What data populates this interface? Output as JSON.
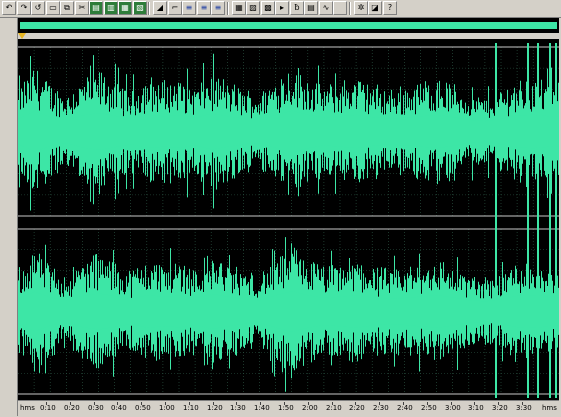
{
  "toolbar": {
    "groups": [
      [
        {
          "name": "undo-button",
          "icon": "undo-icon",
          "glyph": "↶"
        },
        {
          "name": "redo-button",
          "icon": "redo-icon",
          "glyph": "↷"
        },
        {
          "name": "repeat-command-button",
          "icon": "repeat-icon",
          "glyph": "↺"
        },
        {
          "name": "open-button",
          "icon": "folder-icon",
          "glyph": "▭"
        },
        {
          "name": "copy-button",
          "icon": "copy-icon",
          "glyph": "⧉"
        },
        {
          "name": "cut-button",
          "icon": "scissors-icon",
          "glyph": "✂"
        },
        {
          "name": "paste-button",
          "icon": "paste-icon",
          "glyph": "▤"
        },
        {
          "name": "mix-paste-button",
          "icon": "mix-paste-icon",
          "glyph": "▥"
        },
        {
          "name": "trim-button",
          "icon": "trim-icon",
          "glyph": "▦"
        },
        {
          "name": "extract-button",
          "icon": "extract-icon",
          "glyph": "▧"
        }
      ],
      [
        {
          "name": "crossfade-button",
          "icon": "crossfade-icon",
          "glyph": "◢"
        },
        {
          "name": "fade-button",
          "icon": "fade-icon",
          "glyph": "⌐"
        },
        {
          "name": "view-left-channel-button",
          "icon": "channel-icon",
          "glyph": "≡"
        },
        {
          "name": "view-right-channel-button",
          "icon": "channel-icon",
          "glyph": "≡"
        },
        {
          "name": "view-stereo-button",
          "icon": "stereo-icon",
          "glyph": "≡"
        }
      ],
      [
        {
          "name": "frequency-analysis-button",
          "icon": "grid-icon",
          "glyph": "▦"
        },
        {
          "name": "spectral-view-button",
          "icon": "spectral-icon",
          "glyph": "▨"
        },
        {
          "name": "statistics-button",
          "icon": "stats-icon",
          "glyph": "▩"
        },
        {
          "name": "play-button",
          "icon": "play-icon",
          "glyph": "▸"
        },
        {
          "name": "bit-depth-button",
          "icon": "bits-icon",
          "glyph": "ƀ"
        },
        {
          "name": "sample-rate-button",
          "icon": "rate-icon",
          "glyph": "▤"
        },
        {
          "name": "waveform-button",
          "icon": "waveform-icon",
          "glyph": "∿"
        },
        {
          "name": "blank-button",
          "icon": "blank-icon",
          "glyph": ""
        }
      ],
      [
        {
          "name": "settings-button",
          "icon": "gear-icon",
          "glyph": "✲"
        },
        {
          "name": "script-button",
          "icon": "script-icon",
          "glyph": "◪"
        },
        {
          "name": "help-button",
          "icon": "help-icon",
          "glyph": "?"
        }
      ]
    ]
  },
  "colors": {
    "waveform": "#3de6a6",
    "background": "#000000",
    "grid": "#2e5a48",
    "overview": "#3de6a6",
    "chrome": "#d4d0c8",
    "channel-divider": "#c8c8c8",
    "marker": "#e6b422"
  },
  "timeline": {
    "unit": "hms",
    "unit_right": "hms",
    "labels": [
      "0:10",
      "0:20",
      "0:30",
      "0:40",
      "0:50",
      "1:00",
      "1:10",
      "1:20",
      "1:30",
      "1:40",
      "1:50",
      "2:00",
      "2:10",
      "2:20",
      "2:30",
      "2:40",
      "2:50",
      "3:00",
      "3:10",
      "3:20",
      "3:30"
    ]
  },
  "waveform": {
    "channels": [
      "left",
      "right"
    ],
    "envelope_by_second": [
      0.55,
      0.88,
      0.62,
      0.5,
      0.7,
      0.8,
      0.68,
      0.55,
      0.72,
      0.66,
      0.7,
      0.6,
      0.78,
      0.66,
      0.55,
      0.5,
      0.72,
      0.9,
      0.72,
      0.6,
      0.66,
      0.72,
      0.62,
      0.55,
      0.6,
      0.66,
      0.72,
      0.62,
      0.5,
      0.45,
      0.55,
      0.7,
      0.72,
      0.66,
      0.62,
      0.5,
      0.42,
      0.55,
      0.95,
      0.8,
      0.72,
      0.78,
      0.7,
      0.6,
      0.55,
      0.5,
      0.45,
      0.5,
      0.55,
      1.0,
      0.62,
      0.95,
      1.0,
      0.45
    ]
  }
}
